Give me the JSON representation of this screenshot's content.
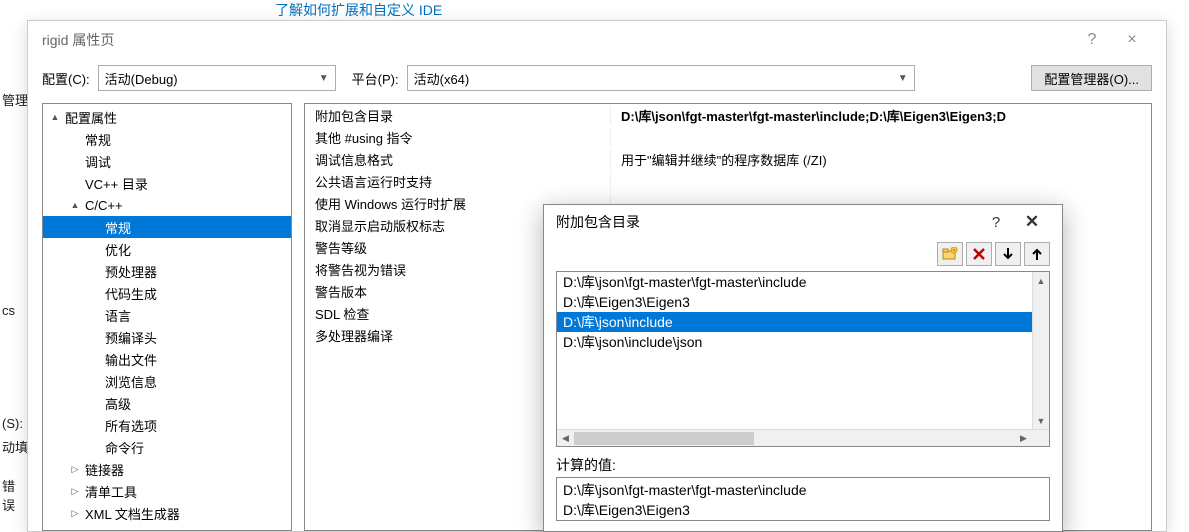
{
  "back_link": "了解如何扩展和自定义 IDE",
  "left_fragments": {
    "f1": "管理",
    "f2": "cs",
    "f3": "(S):",
    "f4": "动填",
    "f5": "错 误"
  },
  "dialog": {
    "title": "rigid 属性页",
    "help": "?",
    "close": "×",
    "config_label": "配置(C):",
    "config_value": "活动(Debug)",
    "platform_label": "平台(P):",
    "platform_value": "活动(x64)",
    "manager_button": "配置管理器(O)..."
  },
  "tree": [
    {
      "label": "配置属性",
      "indent": 0,
      "twisty": "▲"
    },
    {
      "label": "常规",
      "indent": 1
    },
    {
      "label": "调试",
      "indent": 1
    },
    {
      "label": "VC++ 目录",
      "indent": 1
    },
    {
      "label": "C/C++",
      "indent": 1,
      "twisty": "▲"
    },
    {
      "label": "常规",
      "indent": 2,
      "selected": true
    },
    {
      "label": "优化",
      "indent": 2
    },
    {
      "label": "预处理器",
      "indent": 2
    },
    {
      "label": "代码生成",
      "indent": 2
    },
    {
      "label": "语言",
      "indent": 2
    },
    {
      "label": "预编译头",
      "indent": 2
    },
    {
      "label": "输出文件",
      "indent": 2
    },
    {
      "label": "浏览信息",
      "indent": 2
    },
    {
      "label": "高级",
      "indent": 2
    },
    {
      "label": "所有选项",
      "indent": 2
    },
    {
      "label": "命令行",
      "indent": 2
    },
    {
      "label": "链接器",
      "indent": 1,
      "twisty": "▷"
    },
    {
      "label": "清单工具",
      "indent": 1,
      "twisty": "▷"
    },
    {
      "label": "XML 文档生成器",
      "indent": 1,
      "twisty": "▷"
    }
  ],
  "props": [
    {
      "name": "附加包含目录",
      "value": "D:\\库\\json\\fgt-master\\fgt-master\\include;D:\\库\\Eigen3\\Eigen3;D",
      "bold": true
    },
    {
      "name": "其他 #using 指令",
      "value": ""
    },
    {
      "name": "调试信息格式",
      "value": "用于\"编辑并继续\"的程序数据库 (/ZI)",
      "bold": false
    },
    {
      "name": "公共语言运行时支持",
      "value": ""
    },
    {
      "name": "使用 Windows 运行时扩展",
      "value": ""
    },
    {
      "name": "取消显示启动版权标志",
      "value": ""
    },
    {
      "name": "警告等级",
      "value": ""
    },
    {
      "name": "将警告视为错误",
      "value": ""
    },
    {
      "name": "警告版本",
      "value": ""
    },
    {
      "name": "SDL 检查",
      "value": ""
    },
    {
      "name": "多处理器编译",
      "value": ""
    }
  ],
  "sub": {
    "title": "附加包含目录",
    "help": "?",
    "close": "✕",
    "icons": {
      "new_folder": "new-folder-icon",
      "delete": "delete-icon",
      "down": "down-icon",
      "up": "up-icon"
    },
    "list_items": [
      "D:\\库\\json\\fgt-master\\fgt-master\\include",
      "D:\\库\\Eigen3\\Eigen3",
      "D:\\库\\json\\include",
      "D:\\库\\json\\include\\json"
    ],
    "selected_index": 2,
    "computed_label": "计算的值:",
    "computed_values": [
      "D:\\库\\json\\fgt-master\\fgt-master\\include",
      "D:\\库\\Eigen3\\Eigen3"
    ]
  }
}
